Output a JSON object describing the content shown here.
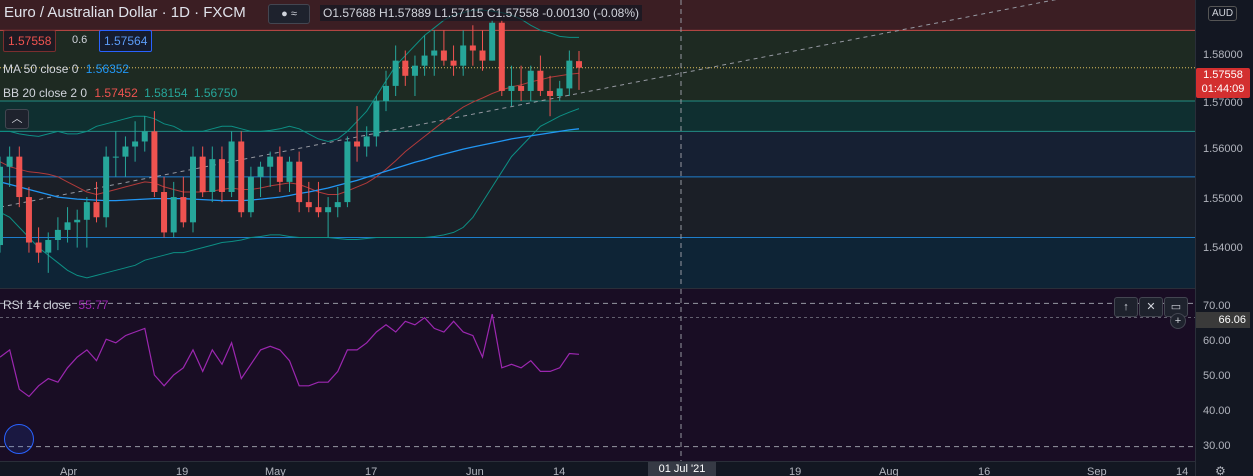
{
  "symbol": {
    "title": "Euro / Australian Dollar · 1D · FXCM",
    "ohlc": "O1.57688 H1.57889 L1.57115 C1.57558 -0.00130 (-0.08%)",
    "sell_price": "1.57558",
    "buy_price": "1.57564",
    "spread": "0.6",
    "currency": "AUD"
  },
  "indicators": {
    "ma_label": "MA 50 close 0",
    "ma_value": "1.56352",
    "bb_label": "BB 20 close 2 0",
    "bb_values": [
      "1.57452",
      "1.58154",
      "1.56750"
    ],
    "rsi_label": "RSI 14 close",
    "rsi_value": "55.77"
  },
  "price_axis": {
    "ticks": [
      "1.58000",
      "1.57000",
      "1.56000",
      "1.55000",
      "1.54000"
    ],
    "current_price": "1.57558",
    "countdown": "01:44:09"
  },
  "rsi_axis": {
    "ticks": [
      "70.00",
      "60.00",
      "50.00",
      "40.00",
      "30.00"
    ],
    "current": "66.06"
  },
  "time_axis": {
    "labels": [
      "Apr",
      "19",
      "May",
      "17",
      "Jun",
      "14",
      "19",
      "Aug",
      "16",
      "Sep",
      "14"
    ],
    "cursor_label": "01 Jul '21"
  },
  "colors": {
    "up": "#26a69a",
    "down": "#ef5350",
    "ma": "#2196f3",
    "bb": "#0d8f84",
    "rsi": "#9c27b0"
  },
  "chart_data": [
    {
      "type": "candlestick",
      "series": [
        {
          "name": "Euro / Australian Dollar",
          "values": [
            [
              1.5405,
              1.558,
              1.539,
              1.556
            ],
            [
              1.556,
              1.56,
              1.552,
              1.558
            ],
            [
              1.558,
              1.56,
              1.548,
              1.55
            ],
            [
              1.55,
              1.552,
              1.539,
              1.541
            ],
            [
              1.541,
              1.544,
              1.537,
              1.539
            ],
            [
              1.539,
              1.543,
              1.535,
              1.5415
            ],
            [
              1.5415,
              1.546,
              1.5395,
              1.5435
            ],
            [
              1.5435,
              1.548,
              1.541,
              1.545
            ],
            [
              1.545,
              1.5475,
              1.54,
              1.5455
            ],
            [
              1.5455,
              1.55,
              1.54,
              1.549
            ],
            [
              1.549,
              1.553,
              1.545,
              1.546
            ],
            [
              1.546,
              1.56,
              1.544,
              1.558
            ],
            [
              1.558,
              1.563,
              1.554,
              1.558
            ],
            [
              1.558,
              1.562,
              1.554,
              1.56
            ],
            [
              1.56,
              1.565,
              1.557,
              1.561
            ],
            [
              1.561,
              1.566,
              1.559,
              1.563
            ],
            [
              1.563,
              1.567,
              1.55,
              1.551
            ],
            [
              1.551,
              1.554,
              1.542,
              1.543
            ],
            [
              1.543,
              1.553,
              1.542,
              1.55
            ],
            [
              1.55,
              1.554,
              1.544,
              1.545
            ],
            [
              1.545,
              1.56,
              1.543,
              1.558
            ],
            [
              1.558,
              1.56,
              1.55,
              1.551
            ],
            [
              1.551,
              1.56,
              1.549,
              1.5575
            ],
            [
              1.5575,
              1.56,
              1.549,
              1.551
            ],
            [
              1.551,
              1.563,
              1.55,
              1.561
            ],
            [
              1.561,
              1.563,
              1.546,
              1.547
            ],
            [
              1.547,
              1.556,
              1.546,
              1.554
            ],
            [
              1.554,
              1.557,
              1.55,
              1.556
            ],
            [
              1.556,
              1.559,
              1.552,
              1.558
            ],
            [
              1.558,
              1.56,
              1.551,
              1.553
            ],
            [
              1.553,
              1.558,
              1.551,
              1.557
            ],
            [
              1.557,
              1.559,
              1.547,
              1.549
            ],
            [
              1.549,
              1.553,
              1.547,
              1.548
            ],
            [
              1.548,
              1.553,
              1.546,
              1.547
            ],
            [
              1.547,
              1.55,
              1.542,
              1.548
            ],
            [
              1.548,
              1.552,
              1.546,
              1.549
            ],
            [
              1.549,
              1.562,
              1.548,
              1.561
            ],
            [
              1.561,
              1.568,
              1.557,
              1.56
            ],
            [
              1.56,
              1.564,
              1.558,
              1.562
            ],
            [
              1.562,
              1.57,
              1.56,
              1.569
            ],
            [
              1.569,
              1.575,
              1.567,
              1.572
            ],
            [
              1.572,
              1.58,
              1.57,
              1.577
            ],
            [
              1.577,
              1.579,
              1.572,
              1.574
            ],
            [
              1.574,
              1.578,
              1.57,
              1.576
            ],
            [
              1.576,
              1.582,
              1.574,
              1.578
            ],
            [
              1.578,
              1.583,
              1.574,
              1.579
            ],
            [
              1.579,
              1.583,
              1.576,
              1.577
            ],
            [
              1.577,
              1.58,
              1.574,
              1.576
            ],
            [
              1.576,
              1.583,
              1.574,
              1.58
            ],
            [
              1.58,
              1.584,
              1.576,
              1.579
            ],
            [
              1.579,
              1.583,
              1.575,
              1.577
            ],
            [
              1.577,
              1.585,
              1.577,
              1.5845
            ],
            [
              1.5845,
              1.585,
              1.57,
              1.571
            ],
            [
              1.571,
              1.576,
              1.568,
              1.572
            ],
            [
              1.572,
              1.576,
              1.569,
              1.571
            ],
            [
              1.571,
              1.576,
              1.569,
              1.575
            ],
            [
              1.575,
              1.578,
              1.57,
              1.571
            ],
            [
              1.571,
              1.574,
              1.566,
              1.57
            ],
            [
              1.57,
              1.573,
              1.569,
              1.5715
            ],
            [
              1.5715,
              1.579,
              1.57,
              1.577
            ],
            [
              1.5769,
              1.5789,
              1.5712,
              1.5756
            ]
          ]
        },
        {
          "name": "MA 50 close 0",
          "values": [
            1.553,
            1.5525,
            1.552,
            1.5515,
            1.551,
            1.5505,
            1.55,
            1.5498,
            1.5496,
            1.5495,
            1.5494,
            1.5493,
            1.5493,
            1.5494,
            1.5495,
            1.5496,
            1.5497,
            1.5497,
            1.5497,
            1.5497,
            1.5496,
            1.5495,
            1.5494,
            1.5493,
            1.5493,
            1.5493,
            1.5494,
            1.5496,
            1.5498,
            1.55,
            1.5503,
            1.5507,
            1.551,
            1.5514,
            1.5518,
            1.5523,
            1.5528,
            1.5533,
            1.5539,
            1.5545,
            1.5551,
            1.5557,
            1.5563,
            1.5569,
            1.5574,
            1.558,
            1.5585,
            1.559,
            1.5595,
            1.5599,
            1.5603,
            1.5607,
            1.5611,
            1.5615,
            1.5618,
            1.5621,
            1.5624,
            1.5627,
            1.563,
            1.5633,
            1.5635
          ]
        },
        {
          "name": "BB 20 close 2 0",
          "values": [
            1.557,
            1.556,
            1.5555,
            1.555,
            1.5548,
            1.5545,
            1.554,
            1.553,
            1.552,
            1.551,
            1.5505,
            1.551,
            1.5515,
            1.552,
            1.5525,
            1.553,
            1.5528,
            1.552,
            1.5515,
            1.551,
            1.551,
            1.551,
            1.5512,
            1.5515,
            1.5518,
            1.5515,
            1.5515,
            1.5518,
            1.5522,
            1.5525,
            1.5528,
            1.5525,
            1.5518,
            1.551,
            1.5505,
            1.5505,
            1.5512,
            1.552,
            1.5528,
            1.554,
            1.5555,
            1.5572,
            1.559,
            1.5605,
            1.562,
            1.5635,
            1.565,
            1.5665,
            1.5678,
            1.5688,
            1.5696,
            1.5705,
            1.5712,
            1.5718,
            1.5722,
            1.5728,
            1.5732,
            1.5737,
            1.574,
            1.5743,
            1.5745
          ]
        },
        {
          "name": "BB upper",
          "values": [
            1.563,
            1.563,
            1.5625,
            1.5622,
            1.562,
            1.5625,
            1.563,
            1.5625,
            1.5625,
            1.563,
            1.564,
            1.5645,
            1.565,
            1.5655,
            1.566,
            1.566,
            1.5655,
            1.5645,
            1.564,
            1.563,
            1.563,
            1.563,
            1.5635,
            1.564,
            1.564,
            1.5635,
            1.563,
            1.563,
            1.5632,
            1.5635,
            1.564,
            1.5635,
            1.5625,
            1.5615,
            1.561,
            1.5615,
            1.563,
            1.565,
            1.567,
            1.57,
            1.573,
            1.576,
            1.578,
            1.58,
            1.582,
            1.5835,
            1.585,
            1.586,
            1.5865,
            1.587,
            1.587,
            1.5868,
            1.5865,
            1.586,
            1.5852,
            1.584,
            1.583,
            1.5825,
            1.5818,
            1.5816,
            1.5816
          ]
        },
        {
          "name": "BB lower",
          "values": [
            1.547,
            1.546,
            1.544,
            1.542,
            1.54,
            1.5385,
            1.537,
            1.5355,
            1.5345,
            1.534,
            1.5345,
            1.535,
            1.5355,
            1.536,
            1.5365,
            1.5375,
            1.538,
            1.5385,
            1.539,
            1.539,
            1.5395,
            1.54,
            1.5405,
            1.541,
            1.5412,
            1.5415,
            1.542,
            1.5422,
            1.5425,
            1.5425,
            1.5422,
            1.542,
            1.542,
            1.542,
            1.542,
            1.5418,
            1.5416,
            1.5416,
            1.5418,
            1.542,
            1.542,
            1.542,
            1.542,
            1.542,
            1.542,
            1.5422,
            1.5425,
            1.543,
            1.544,
            1.546,
            1.549,
            1.552,
            1.555,
            1.558,
            1.56,
            1.562,
            1.564,
            1.565,
            1.566,
            1.5668,
            1.5675
          ]
        }
      ],
      "ylim": [
        1.532,
        1.589
      ],
      "hlines": [
        1.583,
        1.569,
        1.563,
        1.554,
        1.542
      ],
      "current_price_line": 1.57558
    },
    {
      "type": "line",
      "title": "RSI 14 close",
      "series": [
        {
          "name": "RSI 14 close",
          "values": [
            55,
            57,
            46,
            44,
            47,
            49,
            48,
            52,
            55,
            57,
            54,
            60,
            59,
            61,
            62,
            63,
            50,
            47,
            50,
            52,
            57,
            51,
            57,
            53,
            59,
            49,
            53,
            57,
            58,
            57,
            54,
            47,
            47,
            48,
            48,
            51,
            57,
            57,
            59,
            62,
            64,
            62,
            65,
            64,
            66,
            63,
            62,
            65,
            62,
            61,
            55,
            67,
            52,
            53,
            52,
            54,
            51,
            51,
            52,
            56,
            55.77
          ]
        }
      ],
      "ylim": [
        26.0,
        74.0
      ],
      "hlines": [
        70,
        30
      ]
    }
  ]
}
